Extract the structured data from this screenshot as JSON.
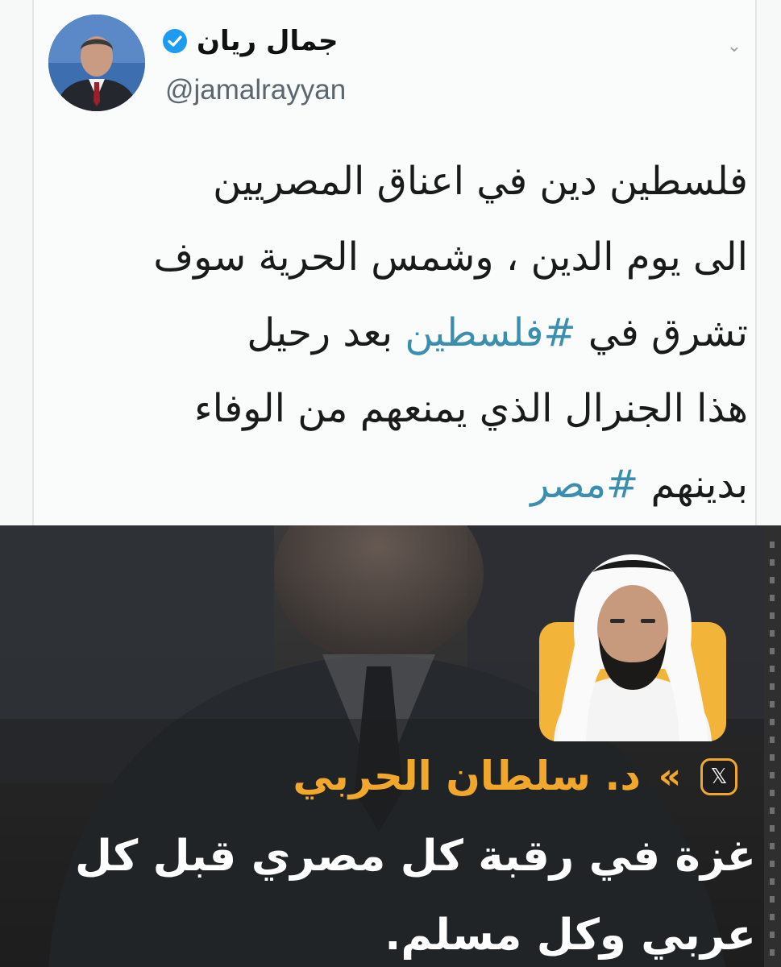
{
  "tweet": {
    "display_name": "جمال ريان",
    "handle": "@jamalrayyan",
    "verified": true,
    "menu_icon": "chevron-down-icon",
    "text_lines": [
      {
        "pre": "فلسطين دين في اعناق المصريين",
        "tag": "",
        "post": ""
      },
      {
        "pre": "الى يوم الدين ، وشمس الحرية سوف",
        "tag": "",
        "post": ""
      },
      {
        "pre": "تشرق في ",
        "tag": "#فلسطين",
        "post": " بعد رحيل"
      },
      {
        "pre": "هذا الجنرال الذي يمنعهم من الوفاء",
        "tag": "",
        "post": ""
      },
      {
        "pre": "بدينهم ",
        "tag": "#مصر",
        "post": ""
      }
    ],
    "hashtag_color": "#3a8fae"
  },
  "news_card": {
    "platform_icon": "x-logo-icon",
    "arrows": "«",
    "person_name": "د. سلطان الحربي",
    "quote_lines": [
      "غزة في رقبة كل مصري قبل كل",
      "عربي وكل مسلم."
    ],
    "accent_color": "#f0a72c"
  }
}
